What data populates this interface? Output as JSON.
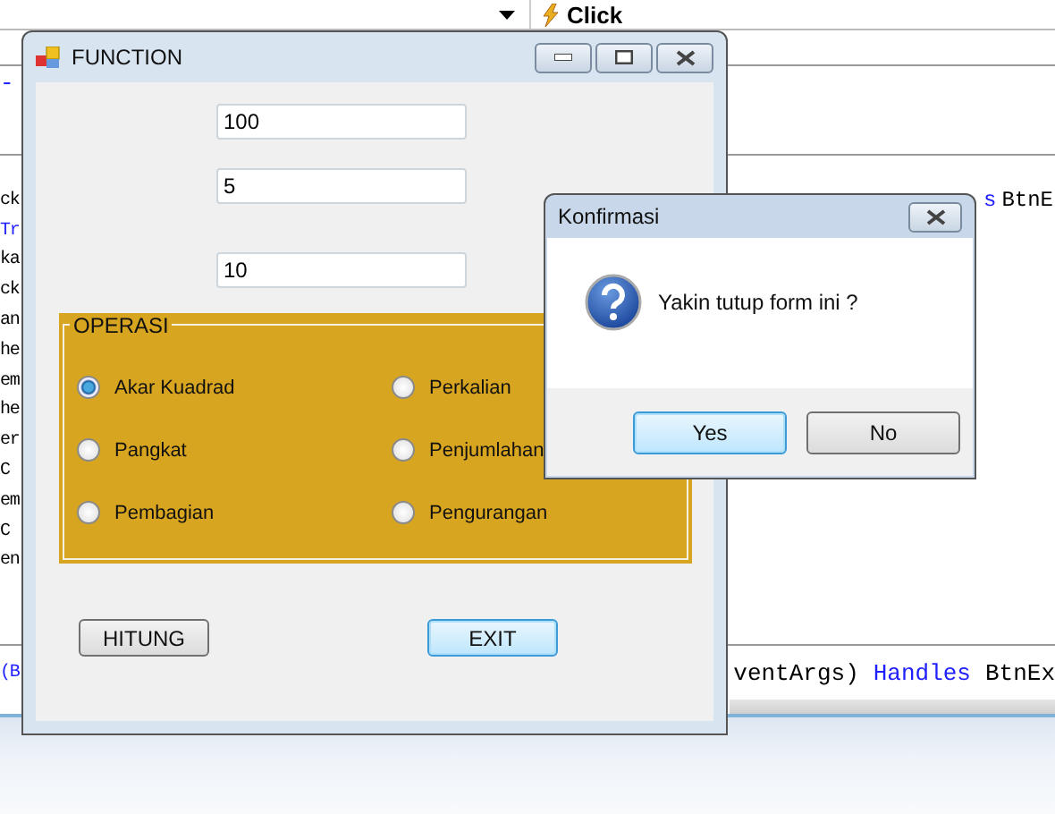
{
  "ide": {
    "event": "Click",
    "top_code": "-",
    "code_lines": [
      {
        "left": "ck",
        "right_keyword": "s",
        "right": "BtnE"
      },
      {
        "left": "Tr",
        "left_keyword": true
      },
      {
        "left": "ka"
      },
      {
        "left": "ck"
      },
      {
        "left": "an"
      },
      {
        "left": "he"
      },
      {
        "left": "em"
      },
      {
        "left": "he"
      },
      {
        "left": "er"
      },
      {
        "left": "C"
      },
      {
        "left": "em"
      },
      {
        "left": "C"
      },
      {
        "left": "en"
      }
    ],
    "bottom_line": {
      "left": "(B",
      "middle": "ventArgs)",
      "keyword": "Handles",
      "right": "BtnEx"
    }
  },
  "function_window": {
    "title": "FUNCTION",
    "fields": [
      {
        "value": "100"
      },
      {
        "value": "5"
      },
      {
        "value": "10"
      }
    ],
    "group": {
      "title": "OPERASI",
      "options": [
        {
          "label": "Akar Kuadrad",
          "selected": true
        },
        {
          "label": "Perkalian",
          "selected": false
        },
        {
          "label": "Pangkat",
          "selected": false
        },
        {
          "label": "Penjumlahan",
          "selected": false
        },
        {
          "label": "Pembagian",
          "selected": false
        },
        {
          "label": "Pengurangan",
          "selected": false
        }
      ]
    },
    "buttons": [
      {
        "label": "HITUNG",
        "focused": false
      },
      {
        "label": "EXIT",
        "focused": true
      }
    ]
  },
  "dialog": {
    "title": "Konfirmasi",
    "message": "Yakin tutup form ini ?",
    "buttons": [
      {
        "label": "Yes",
        "focused": true
      },
      {
        "label": "No",
        "focused": false
      }
    ]
  }
}
